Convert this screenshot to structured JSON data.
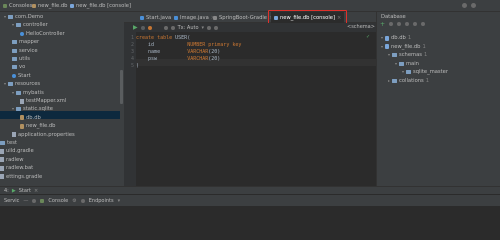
{
  "top_tabs": {
    "consoles": "Consoles",
    "file1": "new_file.db",
    "file2": "new_file.db [console]"
  },
  "left_tree": [
    {
      "label": "com.Demo",
      "indent": 0,
      "type": "folder",
      "expanded": true
    },
    {
      "label": "controller",
      "indent": 1,
      "type": "folder",
      "expanded": true
    },
    {
      "label": "HelloController",
      "indent": 2,
      "type": "class"
    },
    {
      "label": "mapper",
      "indent": 1,
      "type": "folder"
    },
    {
      "label": "service",
      "indent": 1,
      "type": "folder"
    },
    {
      "label": "utils",
      "indent": 1,
      "type": "folder"
    },
    {
      "label": "vo",
      "indent": 1,
      "type": "folder"
    },
    {
      "label": "Start",
      "indent": 1,
      "type": "class"
    },
    {
      "label": "resources",
      "indent": 0,
      "type": "folder",
      "expanded": true
    },
    {
      "label": "mybatis",
      "indent": 1,
      "type": "folder",
      "expanded": true
    },
    {
      "label": "testMapper.xml",
      "indent": 2,
      "type": "xml"
    },
    {
      "label": "static.sqlite",
      "indent": 1,
      "type": "folder",
      "expanded": true,
      "selected": true
    },
    {
      "label": "db.db",
      "indent": 2,
      "type": "db"
    },
    {
      "label": "new_file.db",
      "indent": 2,
      "type": "db"
    },
    {
      "label": "application.properties",
      "indent": 1,
      "type": "props"
    },
    {
      "label": "test",
      "indent": -1,
      "type": "folder"
    },
    {
      "label": "uild.gradle",
      "indent": -1,
      "type": "file"
    },
    {
      "label": "radlew",
      "indent": -1,
      "type": "file"
    },
    {
      "label": "radlew.bat",
      "indent": -1,
      "type": "file"
    },
    {
      "label": "ettings.gradle",
      "indent": -1,
      "type": "file"
    }
  ],
  "editor_tabs": [
    {
      "label": "Start.java",
      "color": "#4a90d9"
    },
    {
      "label": "Image.java",
      "color": "#4a90d9"
    },
    {
      "label": "SpringBoot-Gradle",
      "color": "#888888"
    },
    {
      "label": "new_file.db [console]",
      "color": "#7aa6da",
      "active": true
    }
  ],
  "editor_toolbar": {
    "tx": "Tx: Auto",
    "schema": "<schema>"
  },
  "code": {
    "lines": [
      {
        "n": "1",
        "parts": [
          [
            "kw",
            "create table "
          ],
          [
            "id",
            "USER"
          ],
          [
            "id",
            "("
          ]
        ]
      },
      {
        "n": "2",
        "parts": [
          [
            "id",
            "    id           "
          ],
          [
            "kw",
            "NUMBER primary key"
          ]
        ]
      },
      {
        "n": "3",
        "parts": [
          [
            "id",
            "    name         "
          ],
          [
            "ty",
            "VARCHAR"
          ],
          [
            "id",
            "(20)"
          ]
        ]
      },
      {
        "n": "4",
        "parts": [
          [
            "id",
            "    psw          "
          ],
          [
            "ty",
            "VARCHAR"
          ],
          [
            "id",
            "(20)"
          ]
        ]
      },
      {
        "n": "5",
        "parts": [
          [
            "id",
            ")"
          ]
        ]
      }
    ]
  },
  "database_panel": {
    "title": "Database",
    "items": [
      {
        "label": "db.db",
        "count": "1",
        "indent": 0
      },
      {
        "label": "new_file.db",
        "count": "1",
        "indent": 0
      },
      {
        "label": "schemas",
        "count": "1",
        "indent": 1
      },
      {
        "label": "main",
        "count": "",
        "indent": 2
      },
      {
        "label": "sqlite_master",
        "count": "",
        "indent": 3
      },
      {
        "label": "collations",
        "count": "1",
        "indent": 1
      }
    ]
  },
  "bottom_bar": {
    "tab1": "Start",
    "tools": [
      "Console",
      "Endpoints"
    ]
  },
  "colors": {
    "highlight_box": "#e0312b",
    "selection": "#0d293e",
    "panel": "#3c3f41",
    "editor": "#2b2b2b"
  }
}
